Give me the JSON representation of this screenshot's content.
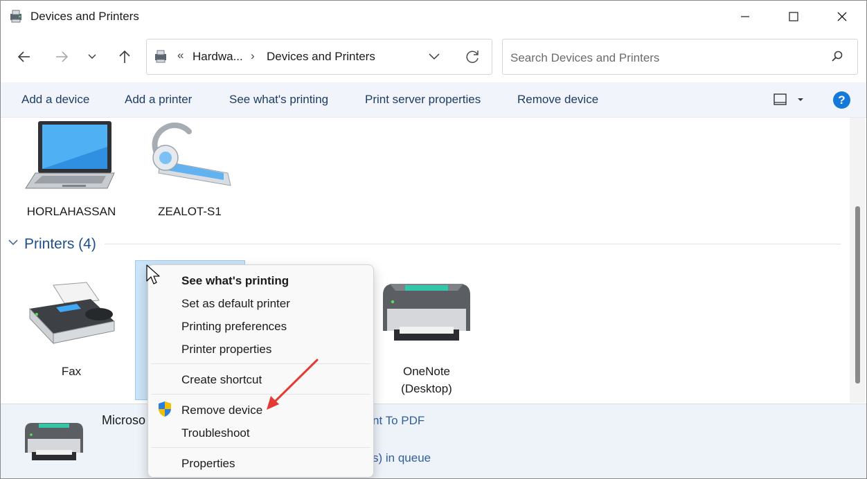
{
  "window": {
    "title": "Devices and Printers"
  },
  "address_bar": {
    "overflow": "«",
    "crumbs": [
      "Hardwa...",
      "Devices and Printers"
    ],
    "separator": "›"
  },
  "search": {
    "placeholder": "Search Devices and Printers"
  },
  "command_bar": {
    "items": [
      "Add a device",
      "Add a printer",
      "See what's printing",
      "Print server properties",
      "Remove device"
    ],
    "help_label": "?"
  },
  "devices": [
    {
      "label": "HORLAHASSAN",
      "icon": "laptop-icon"
    },
    {
      "label": "ZEALOT-S1",
      "icon": "headset-icon"
    }
  ],
  "printers_group": {
    "title": "Printers (4)"
  },
  "printers": [
    {
      "label": "Fax",
      "icon": "fax-icon"
    },
    {
      "label_line1": "OneNote",
      "label_line2": "(Desktop)",
      "icon": "printer-icon"
    }
  ],
  "details": {
    "name": "Microso",
    "model": "nt To PDF",
    "queue": "s) in queue"
  },
  "context_menu": {
    "items": [
      {
        "label": "See what's printing",
        "bold": true
      },
      {
        "label": "Set as default printer"
      },
      {
        "label": "Printing preferences"
      },
      {
        "label": "Printer properties"
      },
      {
        "label": "Create shortcut"
      },
      {
        "label": "Remove device",
        "icon": "shield-icon"
      },
      {
        "label": "Troubleshoot"
      },
      {
        "label": "Properties"
      }
    ]
  },
  "colors": {
    "accent": "#1479d8",
    "link_text": "#1c3c64",
    "selection": "#cce4f7",
    "annotation_arrow": "#e53935"
  }
}
